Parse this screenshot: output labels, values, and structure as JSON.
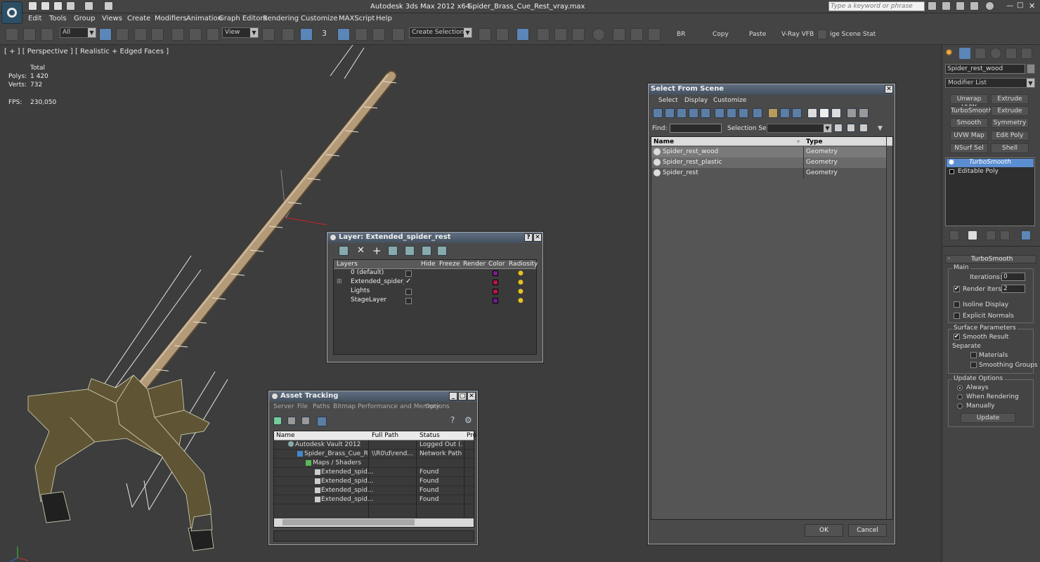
{
  "app": {
    "title": "Autodesk 3ds Max  2012 x64",
    "file": "Spider_Brass_Cue_Rest_vray.max",
    "search_placeholder": "Type a keyword or phrase"
  },
  "menu": [
    "Edit",
    "Tools",
    "Group",
    "Views",
    "Create",
    "Modifiers",
    "Animation",
    "Graph Editors",
    "Rendering",
    "Customize",
    "MAXScript",
    "Help"
  ],
  "toolbar": {
    "filter": "All",
    "ref_coord": "View",
    "selection_set": "Create Selection Se",
    "text_buttons": [
      "BR",
      "Copy",
      "Paste",
      "V-Ray VFB",
      "ige Scene Stat"
    ],
    "snap_label": "3"
  },
  "viewport": {
    "label": "[ + ] [ Perspective ] [ Realistic + Edged Faces ]",
    "stats": {
      "header": "Total",
      "polys_label": "Polys:",
      "polys": "1 420",
      "verts_label": "Verts:",
      "verts": "732",
      "fps_label": "FPS:",
      "fps": "230,050"
    }
  },
  "layer_dialog": {
    "title": "Layer: Extended_spider_rest",
    "columns": [
      "Layers",
      "Hide",
      "Freeze",
      "Render",
      "Color",
      "Radiosity"
    ],
    "rows": [
      {
        "name": "0 (default)",
        "current": false,
        "color": "#7a1f8a"
      },
      {
        "name": "Extended_spider_re",
        "current": true,
        "color": "#b2184a"
      },
      {
        "name": "Lights",
        "current": false,
        "color": "#b2184a"
      },
      {
        "name": "StageLayer",
        "current": false,
        "color": "#6a1e8e"
      }
    ]
  },
  "asset_tracking": {
    "title": "Asset Tracking",
    "menu": [
      "Server",
      "File",
      "Paths",
      "Bitmap Performance and Memory",
      "Options"
    ],
    "columns": [
      "Name",
      "Full Path",
      "Status",
      "Pro"
    ],
    "rows": [
      {
        "name": "Autodesk Vault 2012",
        "path": "",
        "status": "Logged Out (..."
      },
      {
        "name": "Spider_Brass_Cue_R...",
        "path": "\\\\R0\\d\\rend...",
        "status": "Network Path"
      },
      {
        "name": "Maps / Shaders",
        "path": "",
        "status": ""
      },
      {
        "name": "Extended_spid...",
        "path": "",
        "status": "Found"
      },
      {
        "name": "Extended_spid...",
        "path": "",
        "status": "Found"
      },
      {
        "name": "Extended_spid...",
        "path": "",
        "status": "Found"
      },
      {
        "name": "Extended_spid...",
        "path": "",
        "status": "Found"
      }
    ]
  },
  "select_from_scene": {
    "title": "Select From Scene",
    "menu": [
      "Select",
      "Display",
      "Customize"
    ],
    "find_label": "Find:",
    "selset_label": "Selection Set:",
    "columns": [
      "Name",
      "Type"
    ],
    "rows": [
      {
        "name": "Spider_rest_wood",
        "type": "Geometry"
      },
      {
        "name": "Spider_rest_plastic",
        "type": "Geometry"
      },
      {
        "name": "Spider_rest",
        "type": "Geometry"
      }
    ],
    "ok": "OK",
    "cancel": "Cancel"
  },
  "command_panel": {
    "object_name": "Spider_rest_wood",
    "modifier_list": "Modifier List",
    "mod_buttons": [
      "Unwrap UVW",
      "Extrude",
      "TurboSmooth",
      "Extrude",
      "Smooth",
      "Symmetry",
      "UVW Map",
      "Edit Poly",
      "NSurf Sel",
      "Shell"
    ],
    "stack": [
      "TurboSmooth",
      "Editable Poly"
    ],
    "rollout_title": "TurboSmooth",
    "main_label": "Main",
    "iterations_label": "Iterations:",
    "iterations": "0",
    "render_iters_label": "Render Iters:",
    "render_iters": "2",
    "isoline": "Isoline Display",
    "explicit": "Explicit Normals",
    "surface_params": "Surface Parameters",
    "smooth_result": "Smooth Result",
    "separate": "Separate",
    "materials": "Materials",
    "smoothing_groups": "Smoothing Groups",
    "update_options": "Update Options",
    "always": "Always",
    "when_rendering": "When Rendering",
    "manually": "Manually",
    "update": "Update"
  }
}
